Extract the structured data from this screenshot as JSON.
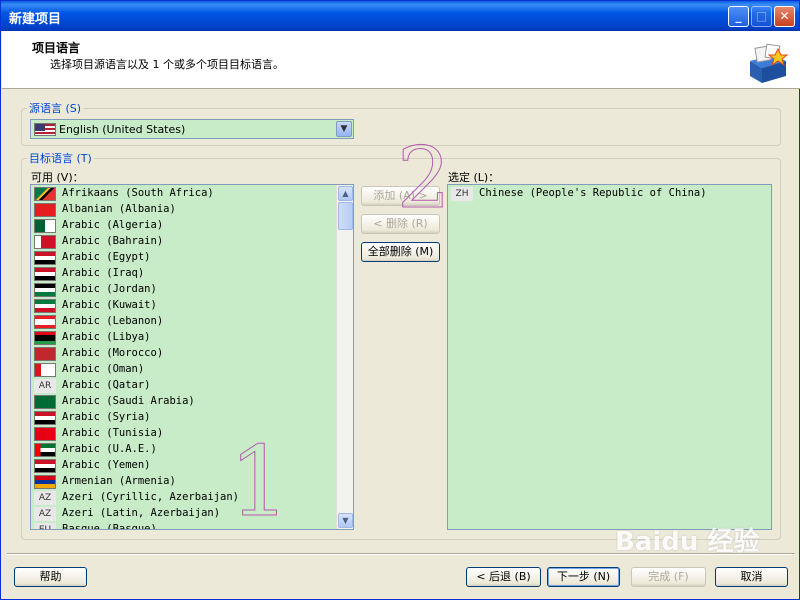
{
  "window": {
    "title": "新建项目",
    "minimize_glyph": "_",
    "maximize_glyph": "□",
    "close_glyph": "✕"
  },
  "header": {
    "title": "项目语言",
    "subtitle": "选择项目源语言以及 1 个或多个项目目标语言。",
    "logo_icon": "project-box-icon"
  },
  "source_language": {
    "legend": "源语言 (S)",
    "selected_value": "English (United States)",
    "flag": "us-flag-icon"
  },
  "target_language": {
    "legend": "目标语言 (T)",
    "available_label": "可用 (V)：",
    "selected_label": "选定 (L)：",
    "available": [
      {
        "name": "Afrikaans (South Africa)",
        "flag": "za"
      },
      {
        "name": "Albanian (Albania)",
        "flag": "al"
      },
      {
        "name": "Arabic (Algeria)",
        "flag": "dz"
      },
      {
        "name": "Arabic (Bahrain)",
        "flag": "bh"
      },
      {
        "name": "Arabic (Egypt)",
        "flag": "eg"
      },
      {
        "name": "Arabic (Iraq)",
        "flag": "iq"
      },
      {
        "name": "Arabic (Jordan)",
        "flag": "jo"
      },
      {
        "name": "Arabic (Kuwait)",
        "flag": "kw"
      },
      {
        "name": "Arabic (Lebanon)",
        "flag": "lb"
      },
      {
        "name": "Arabic (Libya)",
        "flag": "ly"
      },
      {
        "name": "Arabic (Morocco)",
        "flag": "ma"
      },
      {
        "name": "Arabic (Oman)",
        "flag": "om"
      },
      {
        "name": "Arabic (Qatar)",
        "code": "AR"
      },
      {
        "name": "Arabic (Saudi Arabia)",
        "flag": "sa"
      },
      {
        "name": "Arabic (Syria)",
        "flag": "sy"
      },
      {
        "name": "Arabic (Tunisia)",
        "flag": "tn"
      },
      {
        "name": "Arabic (U.A.E.)",
        "flag": "ae"
      },
      {
        "name": "Arabic (Yemen)",
        "flag": "ye"
      },
      {
        "name": "Armenian (Armenia)",
        "flag": "am"
      },
      {
        "name": "Azeri (Cyrillic, Azerbaijan)",
        "code": "AZ"
      },
      {
        "name": "Azeri (Latin, Azerbaijan)",
        "code": "AZ"
      },
      {
        "name": "Basque (Basque)",
        "code": "EU"
      }
    ],
    "selected": [
      {
        "name": "Chinese (People's Republic of China)",
        "code": "ZH"
      }
    ]
  },
  "buttons": {
    "add": "添加 (A) >",
    "remove": "< 删除 (R)",
    "remove_all": "全部删除 (M)",
    "help": "帮助",
    "back": "< 后退 (B)",
    "next": "下一步 (N)",
    "finish": "完成 (F)",
    "cancel": "取消"
  },
  "annotations": {
    "marker_1": "1",
    "marker_2": "2"
  },
  "watermark": "Baidu 经验",
  "colors": {
    "titlebar": "#0055e5",
    "list_background": "#c8ebc8",
    "legend_text": "#0046d5",
    "annotation_stroke": "#b45ab0"
  }
}
